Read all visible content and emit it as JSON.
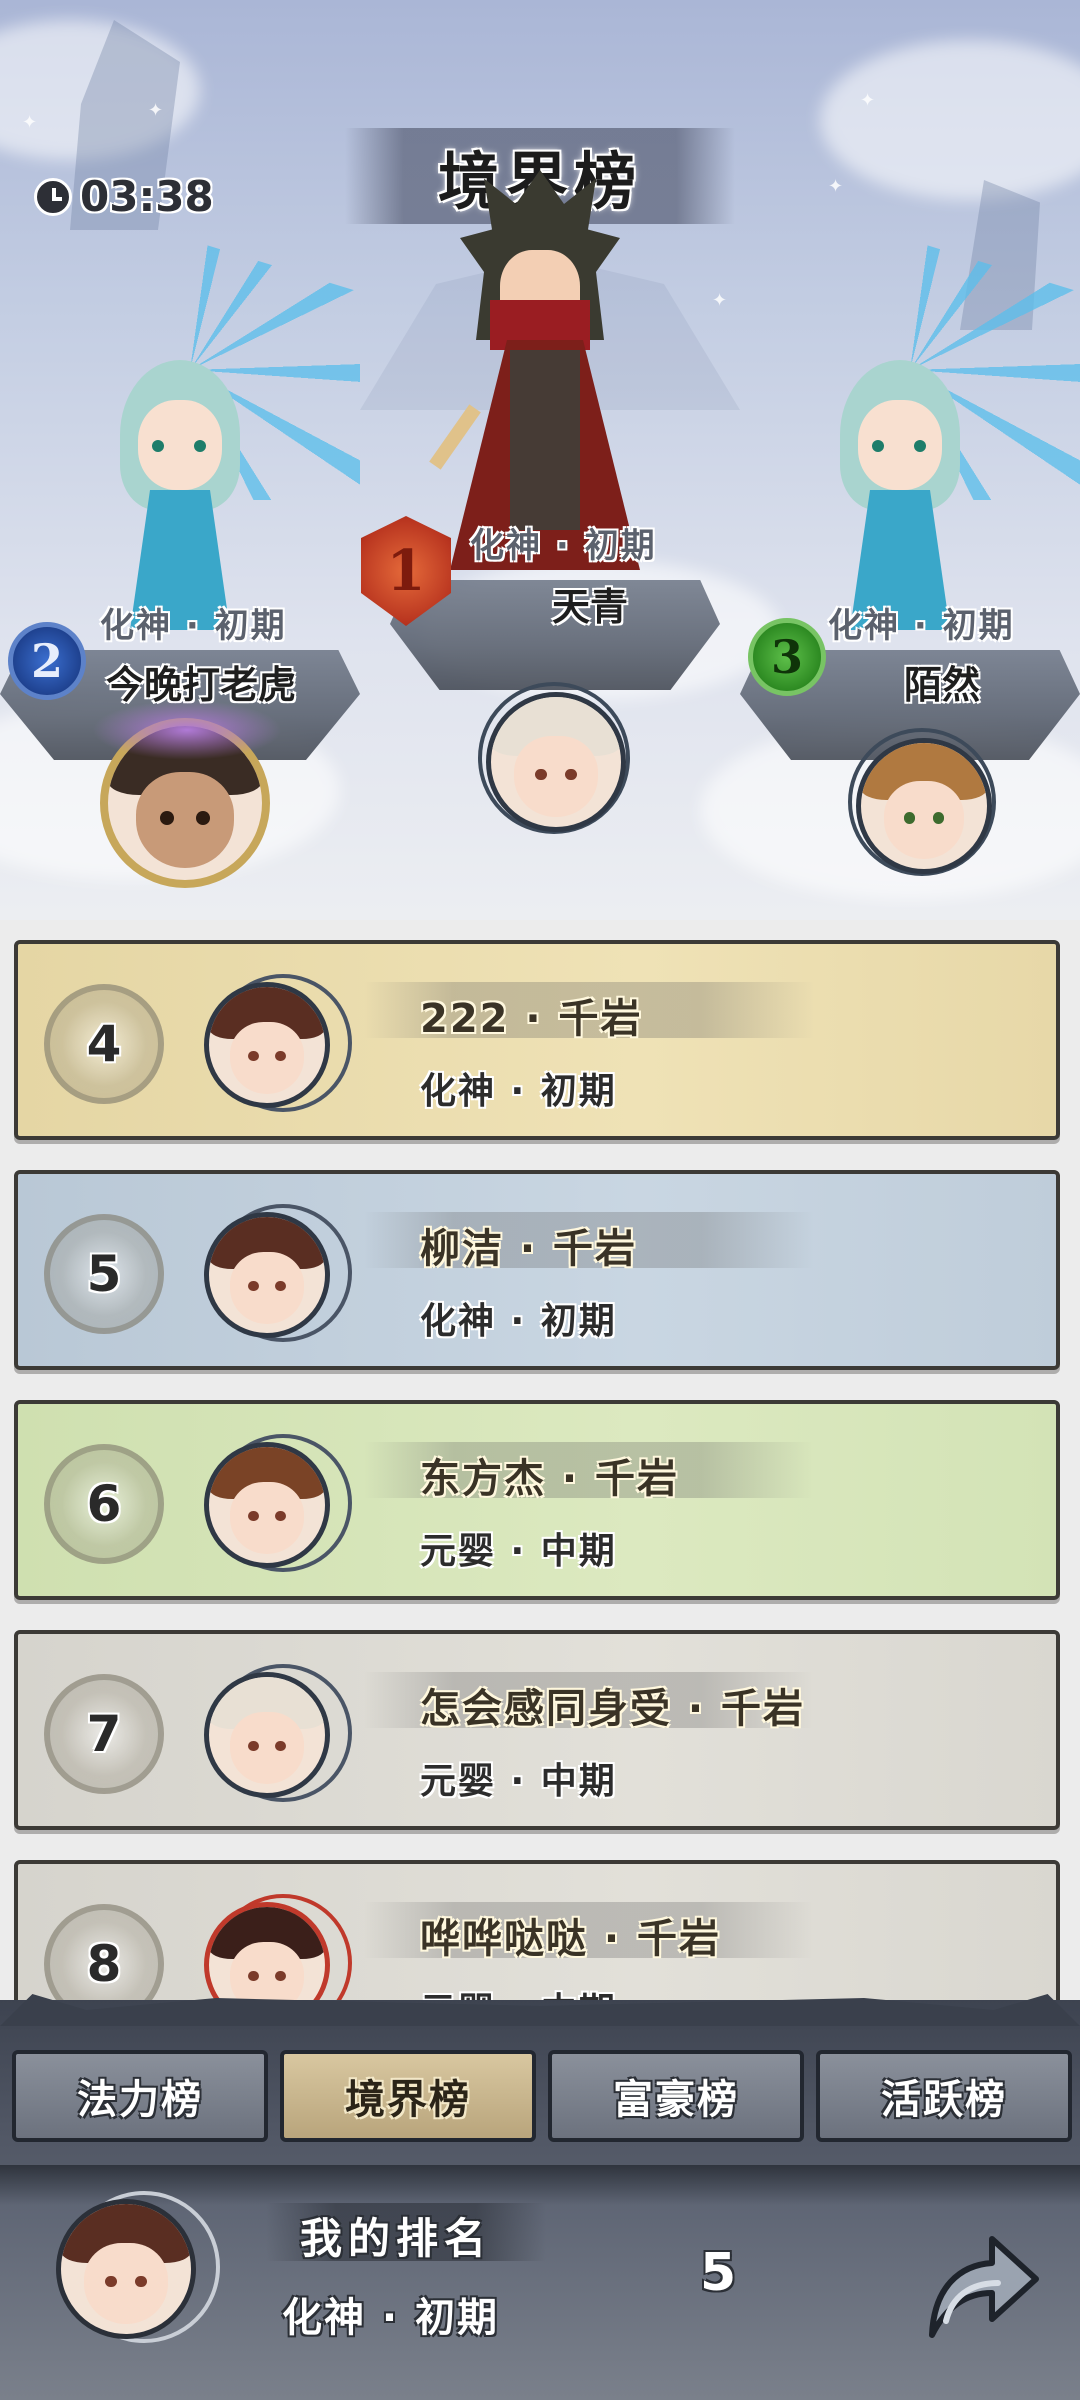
{
  "title": "境界榜",
  "timer": "03:38",
  "podium": [
    {
      "rank": "1",
      "realm": "化神 · 初期",
      "name": "天青"
    },
    {
      "rank": "2",
      "realm": "化神 · 初期",
      "name": "今晚打老虎"
    },
    {
      "rank": "3",
      "realm": "化神 · 初期",
      "name": "陌然"
    }
  ],
  "list": [
    {
      "rank": "4",
      "name": "222 · 千岩",
      "realm": "化神 · 初期"
    },
    {
      "rank": "5",
      "name": "柳洁 · 千岩",
      "realm": "化神 · 初期"
    },
    {
      "rank": "6",
      "name": "东方杰 · 千岩",
      "realm": "元婴 · 中期"
    },
    {
      "rank": "7",
      "name": "怎会感同身受 · 千岩",
      "realm": "元婴 · 中期"
    },
    {
      "rank": "8",
      "name": "哗哗哒哒 · 千岩",
      "realm": "元婴 · 中期"
    }
  ],
  "tabs": [
    "法力榜",
    "境界榜",
    "富豪榜",
    "活跃榜"
  ],
  "active_tab": "境界榜",
  "my_rank": {
    "label": "我的排名",
    "realm": "化神 · 初期",
    "value": "5"
  },
  "icons": {
    "timer": "clock-icon",
    "share": "share-arrow-icon"
  },
  "colors": {
    "row_gold": "#efe2b6",
    "row_blue": "#c9d6e2",
    "row_green": "#dce9c0",
    "row_grey": "#e2e0d9",
    "tab_active": "#c9b68d"
  }
}
